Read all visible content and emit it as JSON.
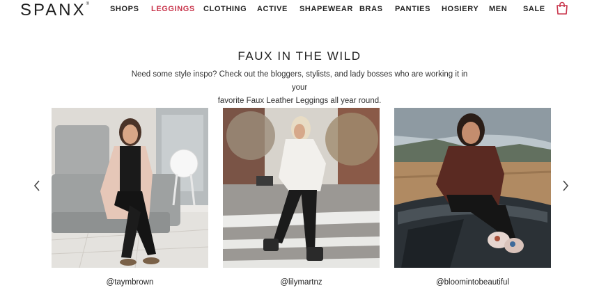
{
  "header": {
    "logo": "SPANX",
    "logo_mark": "®",
    "nav": [
      {
        "label": "SHOPS"
      },
      {
        "label": "LEGGINGS",
        "active": true
      },
      {
        "label": "CLOTHING"
      },
      {
        "label": "ACTIVE"
      },
      {
        "label": "SHAPEWEAR"
      },
      {
        "label": "BRAS"
      },
      {
        "label": "PANTIES"
      },
      {
        "label": "HOSIERY"
      },
      {
        "label": "MEN"
      },
      {
        "label": "SALE"
      }
    ],
    "cart_icon": "shopping-bag-icon"
  },
  "section": {
    "title": "FAUX IN THE WILD",
    "subtitle_line1": "Need some style inspo? Check out the bloggers, stylists, and lady bosses who are working it in your",
    "subtitle_line2": "favorite Faux Leather Leggings all year round."
  },
  "carousel": {
    "prev_icon": "chevron-left-icon",
    "next_icon": "chevron-right-icon",
    "items": [
      {
        "handle": "@taymbrown"
      },
      {
        "handle": "@lilymartnz"
      },
      {
        "handle": "@bloomintobeautiful"
      }
    ]
  },
  "colors": {
    "accent": "#c8334a",
    "text": "#222222"
  }
}
